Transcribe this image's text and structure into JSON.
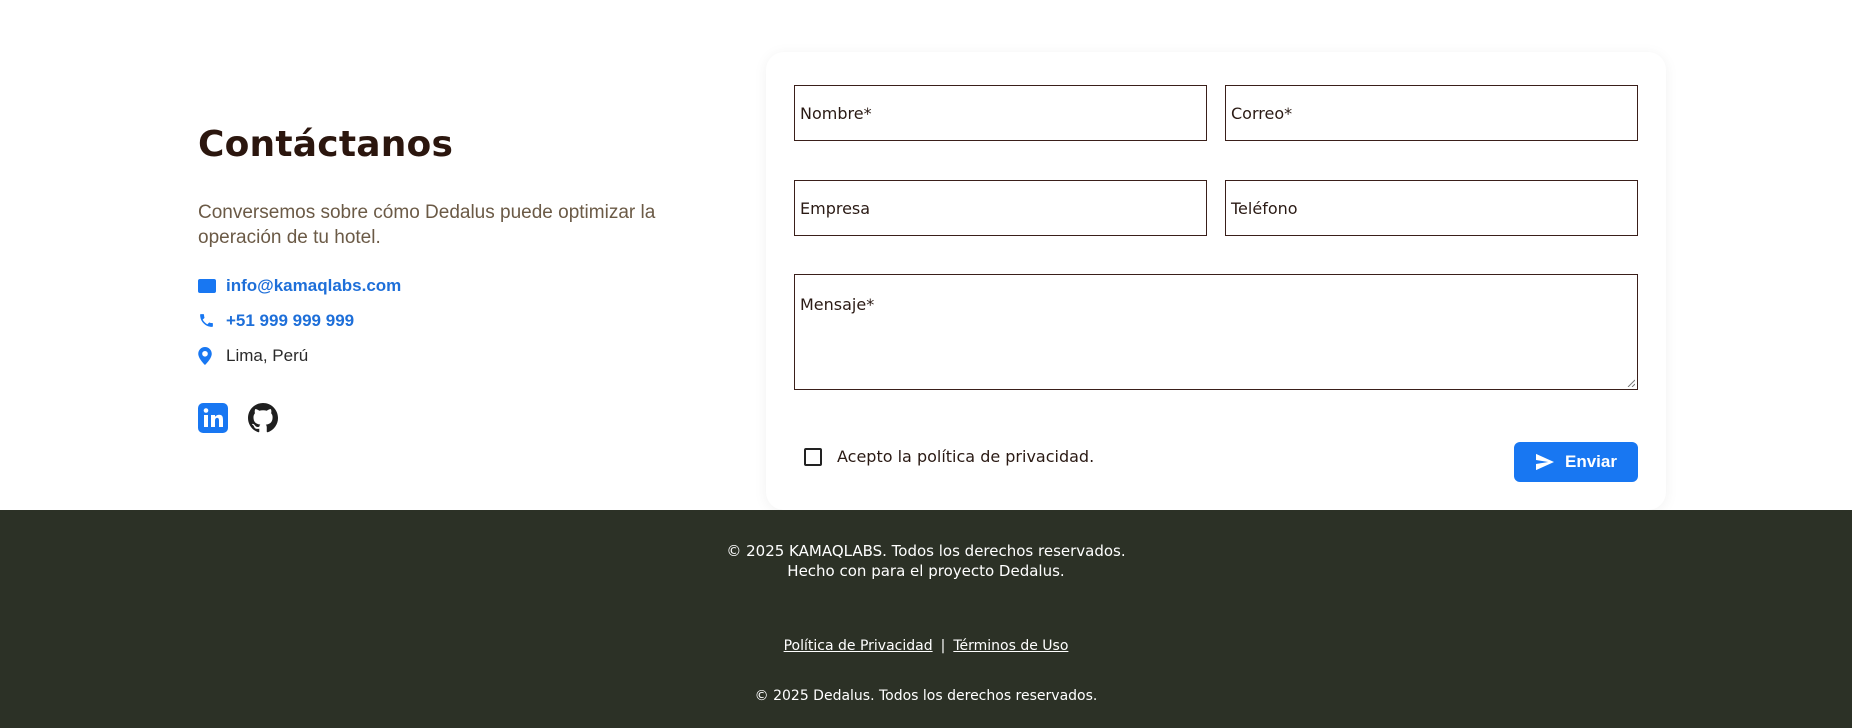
{
  "contact": {
    "title": "Contáctanos",
    "lead": "Conversemos sobre cómo Dedalus puede optimizar la operación de tu hotel.",
    "email": "info@kamaqlabs.com",
    "phone": "+51 999 999 999",
    "location": "Lima, Perú",
    "social": [
      {
        "name": "linkedin-icon",
        "color": "#1877f2"
      },
      {
        "name": "github-icon",
        "color": "#1f1f1f"
      }
    ]
  },
  "form": {
    "name_placeholder": "Nombre*",
    "email_placeholder": "Correo*",
    "company_placeholder": "Empresa",
    "phone_placeholder": "Teléfono",
    "message_placeholder": "Mensaje*",
    "privacy_label": "Acepto la política de privacidad.",
    "privacy_checked": false,
    "submit_label": "Enviar"
  },
  "footer": {
    "line1": "© 2025 KAMAQLABS. Todos los derechos reservados.",
    "line2": "Hecho con para el proyecto Dedalus.",
    "privacy_link": "Política de Privacidad",
    "separator": "|",
    "terms_link": "Términos de Uso",
    "copyright": "© 2025 Dedalus. Todos los derechos reservados."
  },
  "colors": {
    "accent": "#1877f2",
    "title": "#2b160e",
    "footer_bg": "#2c3126"
  }
}
